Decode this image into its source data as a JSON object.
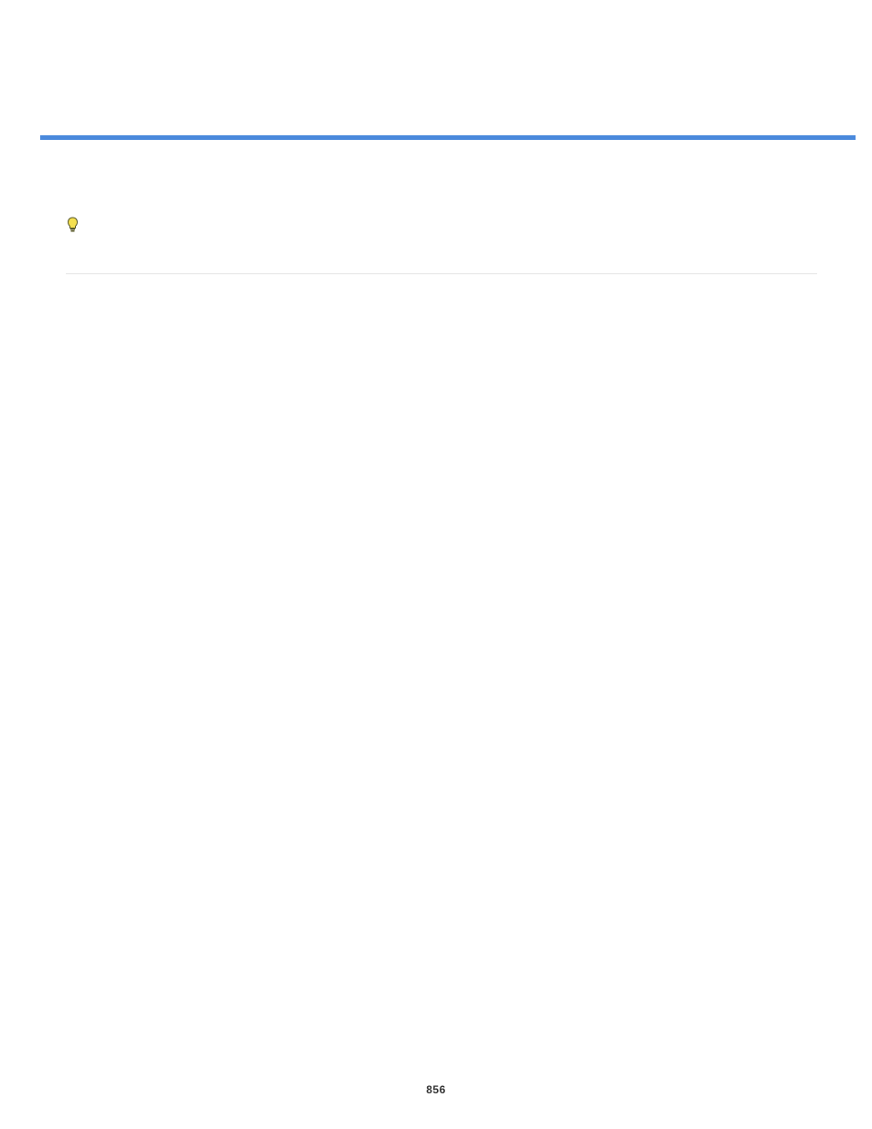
{
  "footer": {
    "page_number": "856"
  }
}
